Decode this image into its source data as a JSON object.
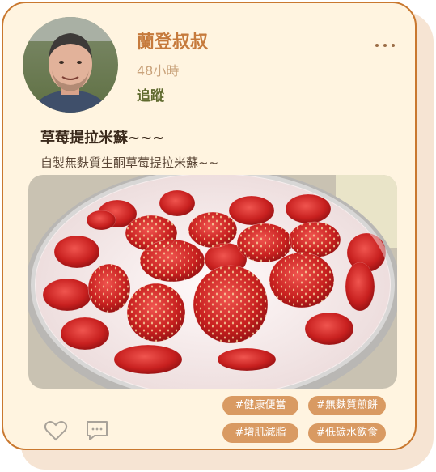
{
  "post": {
    "author": "蘭登叔叔",
    "time_ago": "48小時",
    "follow_label": "追蹤",
    "title": "草莓提拉米蘇~~~",
    "description": "自製無麩質生酮草莓提拉米蘇~~",
    "tags": [
      "#健康便當",
      "#無麩質煎餅",
      "#增肌減脂",
      "#低碳水飲食"
    ]
  },
  "icons": {
    "more": "more-horizontal-icon",
    "like": "heart-icon",
    "comment": "comment-icon"
  },
  "colors": {
    "card_background": "#fff4e0",
    "card_border": "#c9782f",
    "accent": "#c67a3c",
    "follow": "#5f6a2e",
    "tag_background": "#d99a62"
  }
}
